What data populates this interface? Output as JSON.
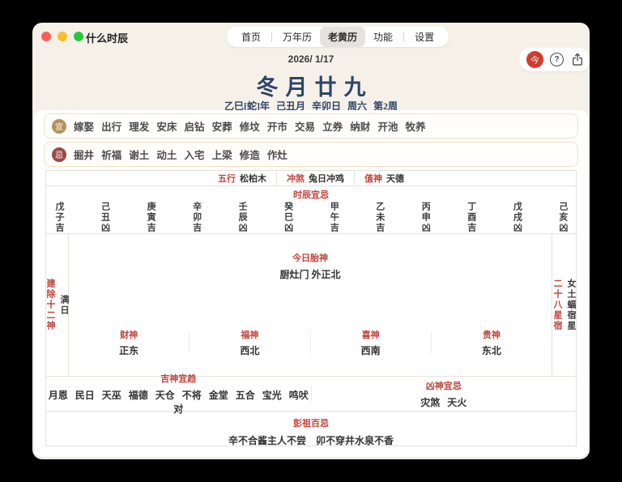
{
  "colors": {
    "accent_red": "#c0443b",
    "navy": "#2e4468",
    "yi_gold": "#b3925d",
    "ji_red": "#9c4a47",
    "today_red": "#d43b2f"
  },
  "titlebar": {
    "app_title": "什么时辰",
    "nav": [
      "首页",
      "万年历",
      "老黄历",
      "功能",
      "设置"
    ],
    "active_tab": "老黄历",
    "today_button": "今",
    "help_glyph": "?"
  },
  "header": {
    "gregorian_date": "2026/ 1/17",
    "lunar_day": "冬月廿九",
    "ganzhi": "乙巳[蛇]年 己丑月 辛卯日 周六 第2周"
  },
  "yi": {
    "badge": "宜",
    "items": [
      "嫁娶",
      "出行",
      "理发",
      "安床",
      "启钻",
      "安葬",
      "修坟",
      "开市",
      "交易",
      "立券",
      "纳财",
      "开池",
      "牧养"
    ]
  },
  "ji": {
    "badge": "忌",
    "items": [
      "掘井",
      "祈福",
      "谢土",
      "动土",
      "入宅",
      "上梁",
      "修造",
      "作灶"
    ]
  },
  "attributes": {
    "wuxing": {
      "label": "五行",
      "value": "松柏木"
    },
    "chongsha": {
      "label": "冲煞",
      "value": "兔日冲鸡"
    },
    "zhishen": {
      "label": "值神",
      "value": "天德"
    }
  },
  "hours": {
    "title": "时辰宜忌",
    "columns": [
      "戊子吉",
      "己丑凶",
      "庚寅吉",
      "辛卯吉",
      "壬辰凶",
      "癸巳凶",
      "甲午吉",
      "乙未吉",
      "丙申凶",
      "丁酉吉",
      "戊戌凶",
      "己亥凶"
    ]
  },
  "jianchu": {
    "label": "建除十二神",
    "value": "满日"
  },
  "xingxiu": {
    "label": "二十八星宿",
    "value": "女土蝠宿星"
  },
  "taishen": {
    "title": "今日胎神",
    "value": "厨灶门 外正北"
  },
  "gods": [
    {
      "label": "财神",
      "value": "正东"
    },
    {
      "label": "福神",
      "value": "西北"
    },
    {
      "label": "喜神",
      "value": "西南"
    },
    {
      "label": "贵神",
      "value": "东北"
    }
  ],
  "jishen": {
    "title": "吉神宜趋",
    "items": [
      "月恩",
      "民日",
      "天巫",
      "福德",
      "天仓",
      "不将",
      "金堂",
      "五合",
      "宝光",
      "鸣吠对"
    ]
  },
  "xiongshen": {
    "title": "凶神宜忌",
    "items": [
      "灾煞",
      "天火"
    ]
  },
  "pengzu": {
    "title": "彭祖百忌",
    "items": [
      "辛不合酱主人不尝",
      "卯不穿井水泉不香"
    ]
  }
}
